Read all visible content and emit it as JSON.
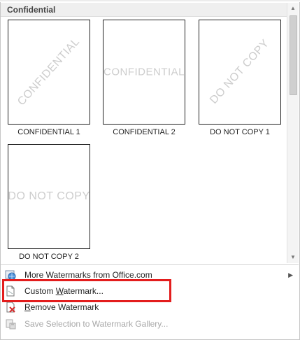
{
  "header": {
    "title": "Confidential"
  },
  "gallery": [
    {
      "watermark": "CONFIDENTIAL",
      "label": "CONFIDENTIAL 1",
      "orientation": "diagonal"
    },
    {
      "watermark": "CONFIDENTIAL",
      "label": "CONFIDENTIAL 2",
      "orientation": "horizontal"
    },
    {
      "watermark": "DO NOT COPY",
      "label": "DO NOT COPY 1",
      "orientation": "diagonal"
    },
    {
      "watermark": "DO NOT COPY",
      "label": "DO NOT COPY 2",
      "orientation": "horizontal"
    }
  ],
  "menu": {
    "more_watermarks": {
      "label": "More Watermarks from Office.com",
      "icon": "globe-icon"
    },
    "custom_watermark": {
      "label_before": "Custom ",
      "label_accel": "W",
      "label_after": "atermark...",
      "icon": "document-icon"
    },
    "remove_watermark": {
      "label_accel": "R",
      "label_after": "emove Watermark",
      "icon": "remove-watermark-icon"
    },
    "save_selection": {
      "label": "Save Selection to Watermark Gallery...",
      "icon": "save-gallery-icon",
      "disabled": true
    }
  },
  "colors": {
    "highlight": "#e31d1d",
    "watermark_text": "#cdcdcd",
    "header_bg": "#efefef"
  }
}
